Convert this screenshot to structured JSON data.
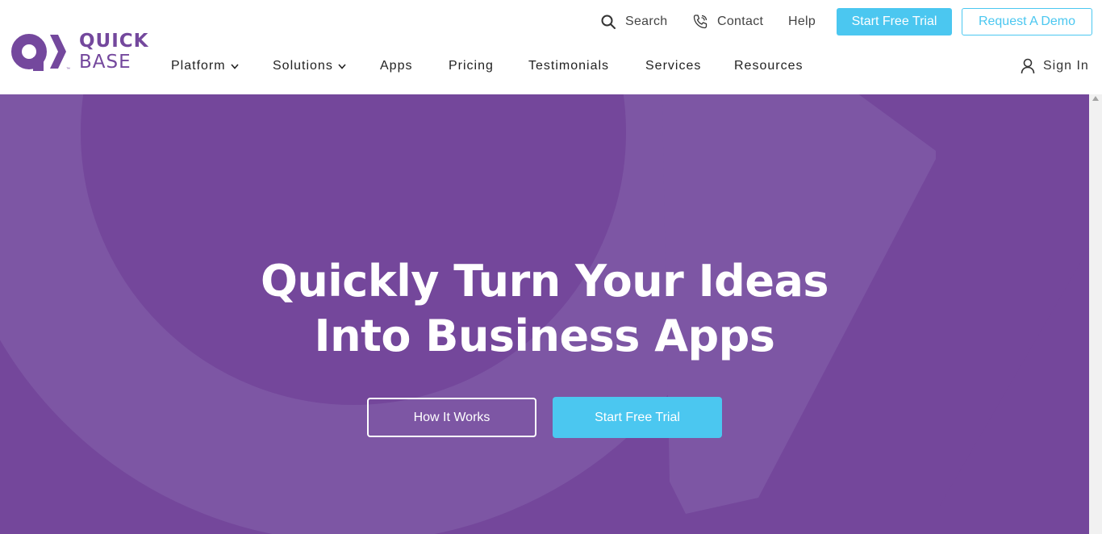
{
  "brand": {
    "word1": "QUICK",
    "word2": "BASE",
    "tm": "™",
    "color": "#74489d"
  },
  "utility": {
    "search_label": "Search",
    "contact_label": "Contact",
    "help_label": "Help",
    "start_trial_label": "Start Free Trial",
    "request_demo_label": "Request A Demo"
  },
  "nav": {
    "items": [
      {
        "label": "Platform",
        "icon": "chevron-down-icon"
      },
      {
        "label": "Solutions",
        "icon": "chevron-down-icon"
      },
      {
        "label": "Apps"
      },
      {
        "label": "Pricing"
      },
      {
        "label": "Testimonials"
      },
      {
        "label": "Services"
      },
      {
        "label": "Resources"
      }
    ],
    "signin_label": "Sign In"
  },
  "hero": {
    "headline_line1": "Quickly Turn Your Ideas",
    "headline_line2": "Into Business Apps",
    "how_it_works_label": "How It Works",
    "start_trial_label": "Start Free Trial"
  },
  "colors": {
    "hero_bg": "#74479b",
    "accent": "#4bc7f0",
    "text_dark": "#222222"
  }
}
